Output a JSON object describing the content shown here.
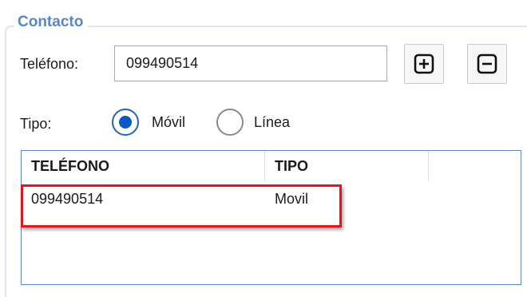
{
  "group": {
    "title": "Contacto"
  },
  "phone": {
    "label": "Teléfono:",
    "value": "099490514",
    "add_icon": "plus-square-icon",
    "remove_icon": "minus-square-icon"
  },
  "type": {
    "label": "Tipo:",
    "options": [
      {
        "label": "Móvil",
        "checked": true
      },
      {
        "label": "Línea",
        "checked": false
      }
    ]
  },
  "table": {
    "columns": [
      "TELÉFONO",
      "TIPO",
      ""
    ],
    "rows": [
      {
        "telefono": "099490514",
        "tipo": "Movil"
      }
    ]
  },
  "colors": {
    "accent": "#0a59c2",
    "group_title": "#5b86c4",
    "highlight": "#e8141c"
  }
}
